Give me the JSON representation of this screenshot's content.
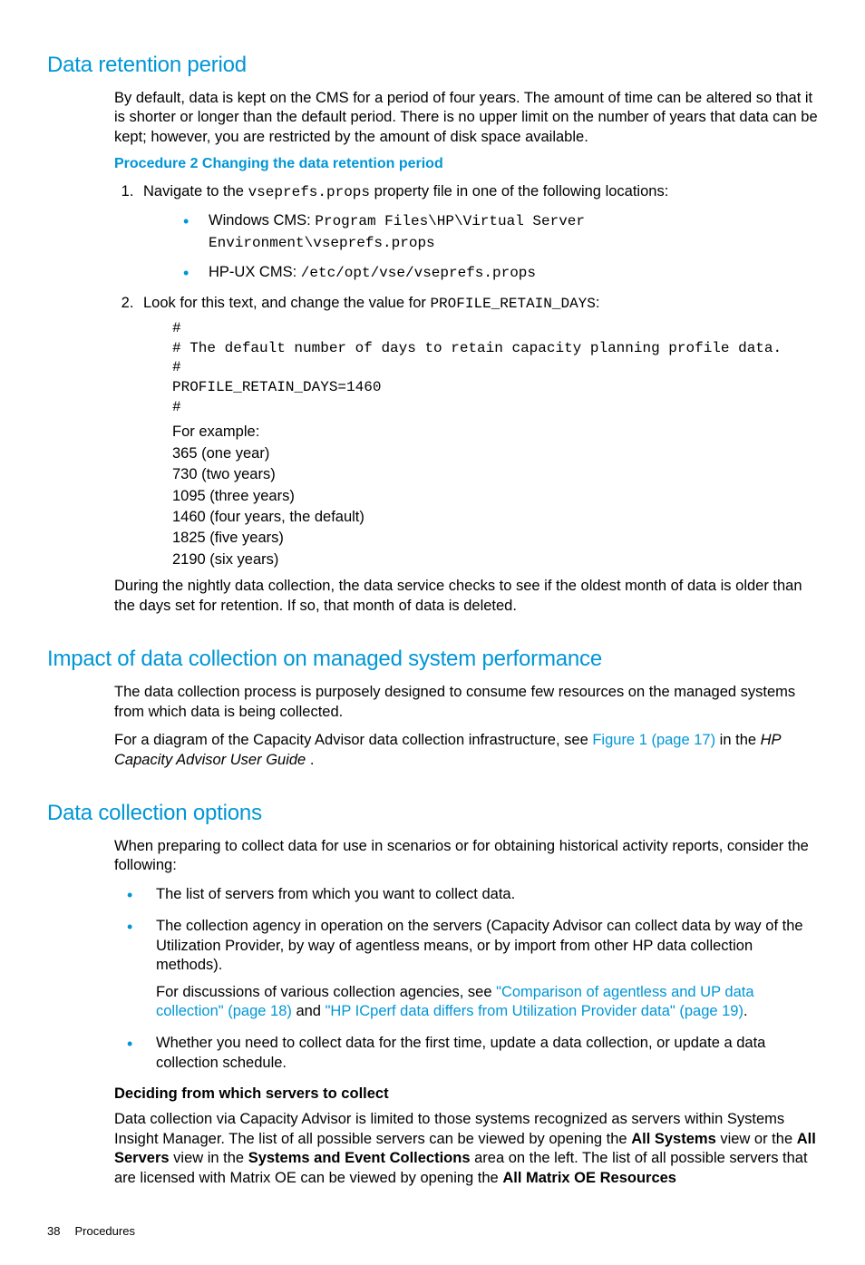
{
  "sections": {
    "retention": {
      "heading": "Data retention period",
      "intro": "By default, data is kept on the CMS for a period of four years. The amount of time can be altered so that it is shorter or longer than the default period. There is no upper limit on the number of years that data can be kept; however, you are restricted by the amount of disk space available.",
      "proc_title": "Procedure 2 Changing the data retention period",
      "step1_pre": "Navigate to the ",
      "step1_code": "vseprefs.props",
      "step1_post": " property file in one of the following locations:",
      "loc1_label": "Windows CMS: ",
      "loc1_code": "Program Files\\HP\\Virtual Server Environment\\vseprefs.props",
      "loc2_label": "HP-UX CMS: ",
      "loc2_code": "/etc/opt/vse/vseprefs.props",
      "step2_pre": "Look for this text, and change the value for ",
      "step2_code": "PROFILE_RETAIN_DAYS",
      "step2_post": ":",
      "codeblock": "#\n# The default number of days to retain capacity planning profile data.\n#\nPROFILE_RETAIN_DAYS=1460\n#",
      "example_label": "For example:",
      "ex1": "365 (one year)",
      "ex2": "730 (two years)",
      "ex3": "1095 (three years)",
      "ex4": "1460 (four years, the default)",
      "ex5": "1825 (five years)",
      "ex6": "2190 (six years)",
      "trailing": "During the nightly data collection, the data service checks to see if the oldest month of data is older than the days set for retention. If so, that month of data is deleted."
    },
    "impact": {
      "heading": "Impact of data collection on managed system performance",
      "p1": "The data collection process is purposely designed to consume few resources on the managed systems from which data is being collected.",
      "p2_pre": "For a diagram of the Capacity Advisor data collection infrastructure, see ",
      "p2_link": "Figure 1 (page 17)",
      "p2_mid": " in the ",
      "p2_italic": "HP Capacity Advisor User Guide",
      "p2_post": " ."
    },
    "options": {
      "heading": "Data collection options",
      "intro": "When preparing to collect data for use in scenarios or for obtaining historical activity reports, consider the following:",
      "b1": "The list of servers from which you want to collect data.",
      "b2": "The collection agency in operation on the servers (Capacity Advisor can collect data by way of the Utilization Provider, by way of agentless means, or by import from other HP data collection methods).",
      "b2_sub_pre": "For discussions of various collection agencies, see ",
      "b2_link1": "\"Comparison of agentless and UP data collection\" (page 18)",
      "b2_sub_mid": " and ",
      "b2_link2": "\"HP ICperf data differs from Utilization Provider data\" (page 19)",
      "b2_sub_post": ".",
      "b3": "Whether you need to collect data for the first time, update a data collection, or update a data collection schedule.",
      "subhead": "Deciding from which servers to collect",
      "sub_p_1": "Data collection via Capacity Advisor is limited to those systems recognized as servers within Systems Insight Manager. The list of all possible servers can be viewed by opening the ",
      "sub_b1": "All Systems",
      "sub_p_2": " view or the ",
      "sub_b2": "All Servers",
      "sub_p_3": " view in the ",
      "sub_b3": "Systems and Event Collections",
      "sub_p_4": " area on the left. The list of all possible servers that are licensed with Matrix OE can be viewed by opening the ",
      "sub_b4": "All Matrix OE Resources"
    }
  },
  "footer": {
    "page_number": "38",
    "section_label": "Procedures"
  }
}
